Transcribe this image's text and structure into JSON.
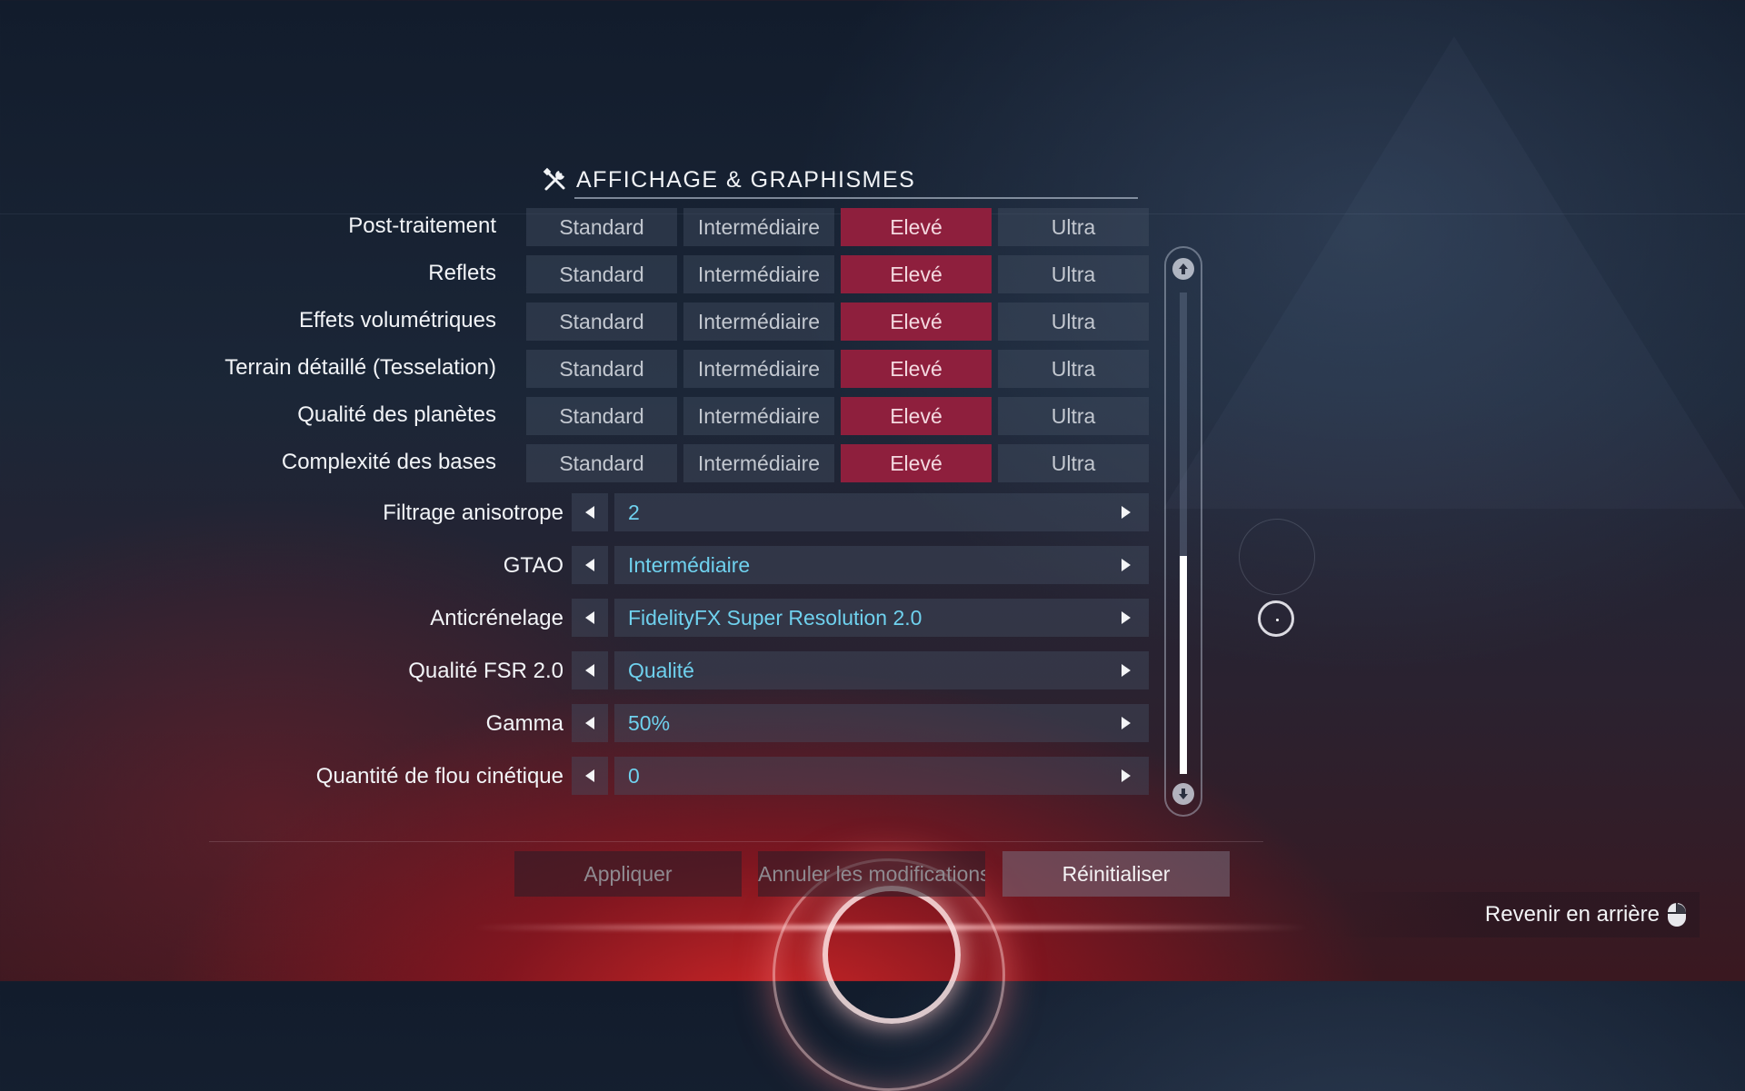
{
  "header": {
    "title": "AFFICHAGE & GRAPHISMES",
    "icon": "tools-icon"
  },
  "quality_options": [
    "Standard",
    "Intermédiaire",
    "Elevé",
    "Ultra"
  ],
  "quality_rows": [
    {
      "label": "Post-traitement",
      "selected": "Elevé"
    },
    {
      "label": "Reflets",
      "selected": "Elevé"
    },
    {
      "label": "Effets volumétriques",
      "selected": "Elevé"
    },
    {
      "label": "Terrain détaillé (Tesselation)",
      "selected": "Elevé"
    },
    {
      "label": "Qualité des planètes",
      "selected": "Elevé"
    },
    {
      "label": "Complexité des bases",
      "selected": "Elevé"
    }
  ],
  "selector_rows": [
    {
      "label": "Filtrage anisotrope",
      "value": "2"
    },
    {
      "label": "GTAO",
      "value": "Intermédiaire"
    },
    {
      "label": "Anticrénelage",
      "value": "FidelityFX Super Resolution 2.0"
    },
    {
      "label": "Qualité FSR 2.0",
      "value": "Qualité"
    },
    {
      "label": "Gamma",
      "value": "50%"
    },
    {
      "label": "Quantité de flou cinétique",
      "value": "0"
    }
  ],
  "actions": {
    "apply": "Appliquer",
    "cancel": "Annuler les modifications",
    "reset": "Réinitialiser"
  },
  "back": {
    "label": "Revenir en arrière",
    "icon": "mouse-icon"
  },
  "colors": {
    "selected_bg": "#8e1f3d",
    "value_text": "#6fd1ee",
    "button_bg": "rgba(70,80,100,0.42)"
  },
  "scrollbar": {
    "position_fraction": 0.55
  }
}
